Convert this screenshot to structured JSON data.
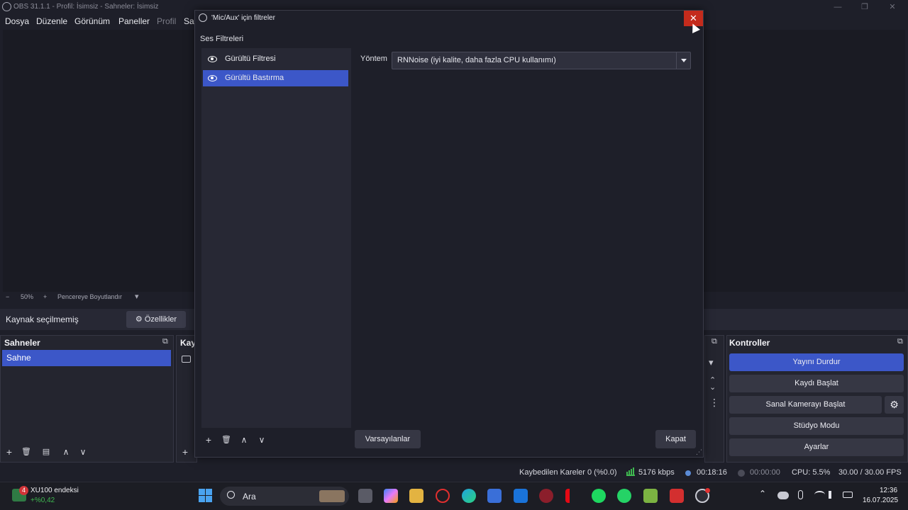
{
  "window": {
    "title": "OBS 31.1.1 - Profil: İsimsiz - Sahneler: İsimsiz",
    "minimize_glyph": "—",
    "maximize_glyph": "❐",
    "close_glyph": "✕"
  },
  "menu": {
    "items": [
      "Dosya",
      "Düzenle",
      "Görünüm",
      "Paneller",
      "Profil",
      "Sa"
    ]
  },
  "zoombar": {
    "minus": "−",
    "zoom": "50%",
    "plus": "+",
    "fit_label": "Pencereye Boyutlandır",
    "dropdown": "▾"
  },
  "source_bar": {
    "status": "Kaynak seçilmemiş",
    "properties_label": "Özellikler",
    "properties_icon": "⚙"
  },
  "scenes_dock": {
    "title": "Sahneler",
    "items": [
      "Sahne"
    ],
    "selected": "Sahne",
    "float_glyph": "⧉",
    "toolbar": {
      "add": "+",
      "remove": "🗑",
      "filter": "▤",
      "up": "∧",
      "down": "∨"
    }
  },
  "sources_dock": {
    "title": "Kay",
    "add": "+"
  },
  "mixer_dock": {
    "float_glyph": "⧉",
    "menu": "⋮",
    "dropdown": "▾",
    "up": "⌃",
    "down": "⌄"
  },
  "controls_dock": {
    "title": "Kontroller",
    "float_glyph": "⧉",
    "buttons": {
      "stream": "Yayını Durdur",
      "record": "Kaydı Başlat",
      "virtualcam": "Sanal Kamerayı Başlat",
      "studio": "Stüdyo Modu",
      "settings": "Ayarlar"
    },
    "virtualcam_settings_icon": "⚙",
    "accent": "#3c57c8"
  },
  "status_bar": {
    "dropped": "Kaybedilen Kareler 0 (%0.0)",
    "bitrate": "5176 kbps",
    "stream_time": "00:18:16",
    "record_time": "00:00:00",
    "cpu": "CPU: 5.5%",
    "fps": "30.00 / 30.00 FPS"
  },
  "dialog": {
    "title": "'Mic/Aux' için filtreler",
    "close_glyph": "✕",
    "section_label": "Ses Filtreleri",
    "filters": [
      "Gürültü Filtresi",
      "Gürültü Bastırma"
    ],
    "selected_filter": "Gürültü Bastırma",
    "method_label": "Yöntem",
    "method_value": "RNNoise (iyi kalite, daha fazla CPU kullanımı)",
    "toolbar": {
      "add": "+",
      "remove": "🗑",
      "up": "∧",
      "down": "∨"
    },
    "defaults_button": "Varsayılanlar",
    "close_button": "Kapat",
    "resize_glyph": "⋰"
  },
  "taskbar": {
    "weather_title": "XU100 endeksi",
    "weather_value": "+%0,42",
    "weather_badge": "4",
    "search_placeholder": "Ara",
    "time": "12:36",
    "date": "16.07.2025",
    "tray_chevron": "⌃",
    "icons": [
      "windows-icon",
      "search-icon",
      "task-view-icon",
      "copilot-icon",
      "file-explorer-icon",
      "opera-icon",
      "edge-icon",
      "store-icon",
      "outlook-icon",
      "app-icon",
      "netflix-icon",
      "spotify-icon",
      "whatsapp-icon",
      "app2-icon",
      "app3-icon",
      "obs-icon"
    ]
  }
}
